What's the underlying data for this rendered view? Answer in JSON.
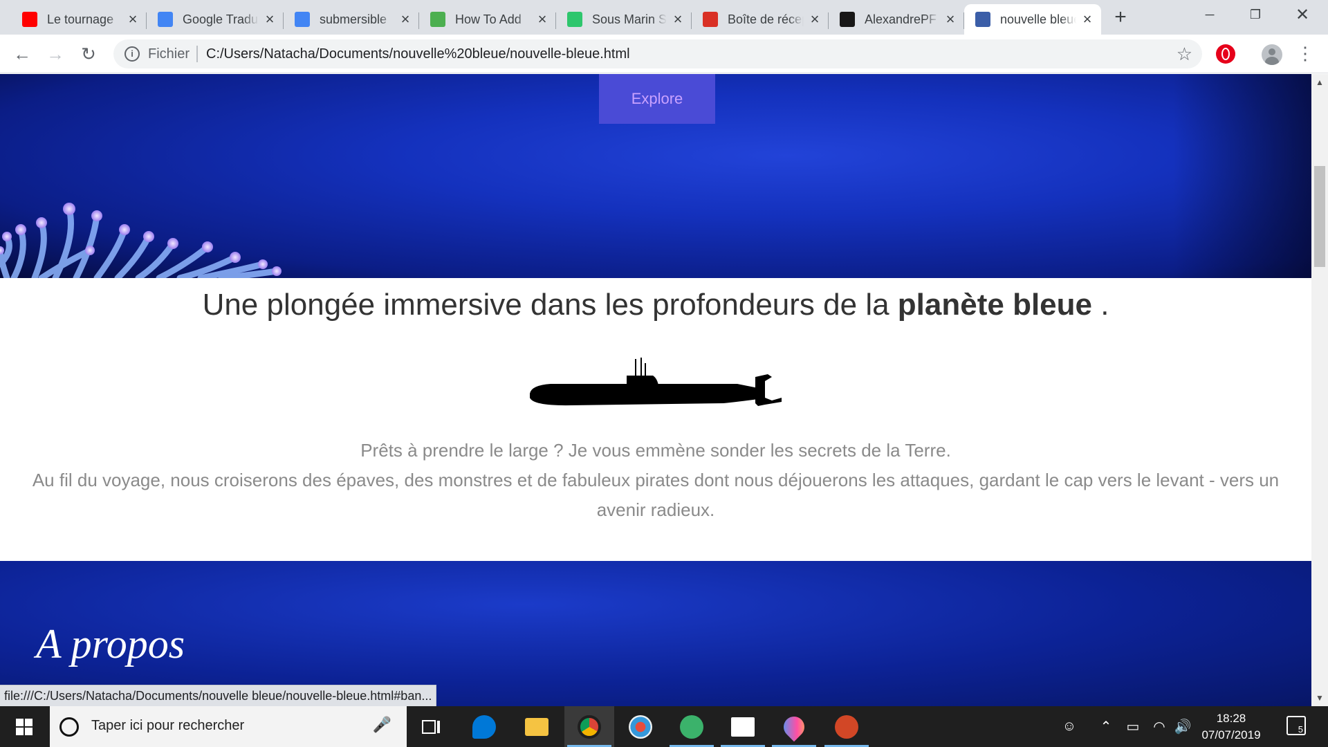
{
  "tabs": [
    {
      "title": "Le tournage",
      "favicon": "youtube-icon",
      "color": "#ff0000"
    },
    {
      "title": "Google Traduction",
      "favicon": "google-translate-icon",
      "color": "#4285f4"
    },
    {
      "title": "submersible",
      "favicon": "google-icon",
      "color": "#4285f4"
    },
    {
      "title": "How To Add",
      "favicon": "w3schools-icon",
      "color": "#4caf50"
    },
    {
      "title": "Sous Marin S",
      "favicon": "pixabay-icon",
      "color": "#2ec66d"
    },
    {
      "title": "Boîte de réception",
      "favicon": "gmail-icon",
      "color": "#d93025"
    },
    {
      "title": "AlexandrePF",
      "favicon": "github-icon",
      "color": "#181717"
    },
    {
      "title": "nouvelle bleue",
      "favicon": "page-icon",
      "color": "#3b5ea8",
      "active": true
    }
  ],
  "toolbar": {
    "scheme": "Fichier",
    "url": "C:/Users/Natacha/Documents/nouvelle%20bleue/nouvelle-bleue.html"
  },
  "page": {
    "explore_label": "Explore",
    "tagline_before": "Une plongée immersive dans les profondeurs de la ",
    "tagline_bold": "planète bleue",
    "tagline_after": " .",
    "para_line1": "Prêts à prendre le large ? Je vous emmène sonder les secrets de la Terre.",
    "para_line2": "Au fil du voyage, nous croiserons des épaves, des monstres et de fabuleux pirates dont nous déjouerons les attaques, gardant le cap vers le levant - vers un avenir radieux.",
    "section_title": "A propos",
    "accent_color": "#4a4bd6"
  },
  "status_url": "file:///C:/Users/Natacha/Documents/nouvelle bleue/nouvelle-bleue.html#ban...",
  "taskbar": {
    "search_placeholder": "Taper ici pour rechercher",
    "time": "18:28",
    "date": "07/07/2019",
    "notification_count": "5"
  }
}
